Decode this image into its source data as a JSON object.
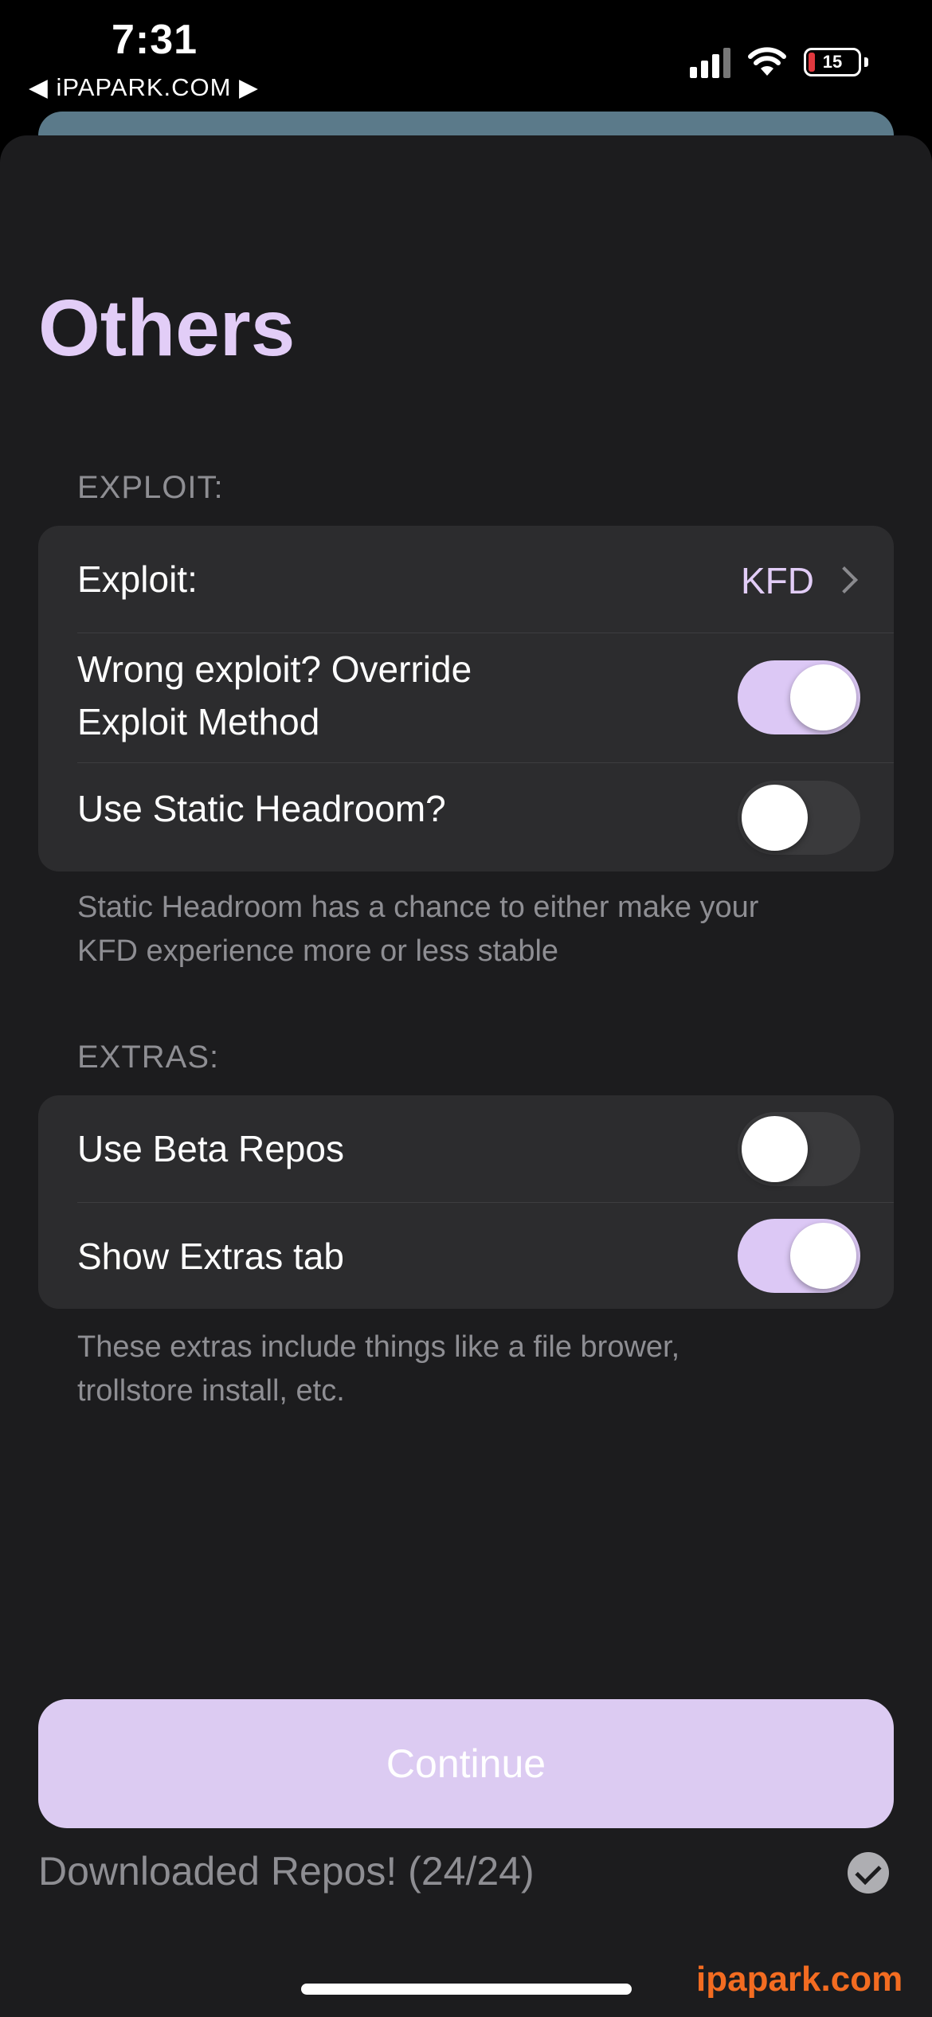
{
  "status_bar": {
    "time": "7:31",
    "back_link": "◀ iPAPARK.COM ▶",
    "battery_level": "15",
    "signal_icon": "cellular-signal-icon",
    "wifi_icon": "wifi-icon",
    "battery_icon": "battery-icon"
  },
  "title": "Others",
  "sections": {
    "exploit": {
      "header": "EXPLOIT:",
      "exploit_row": {
        "label": "Exploit:",
        "value": "KFD"
      },
      "override_row": {
        "label_line1": "Wrong exploit? Override",
        "label_line2": "Exploit Method",
        "enabled": true
      },
      "headroom_row": {
        "label": "Use Static Headroom?",
        "enabled": false
      },
      "footnote_line1": "Static Headroom has a chance to either make your",
      "footnote_line2": "KFD experience more or less stable"
    },
    "extras": {
      "header": "EXTRAS:",
      "beta_row": {
        "label": "Use Beta Repos",
        "enabled": false
      },
      "extras_tab_row": {
        "label": "Show Extras tab",
        "enabled": true
      },
      "footnote_line1": "These extras include things like a file brower,",
      "footnote_line2": "trollstore install, etc."
    }
  },
  "continue_label": "Continue",
  "download_status": "Downloaded Repos! (24/24)",
  "watermark": "ipapark.com",
  "colors": {
    "accent": "#e2cdf7",
    "toggle_on": "#dcc8f5",
    "background": "#1c1c1e",
    "group_background": "#2c2c2e",
    "watermark": "#f36c21"
  }
}
